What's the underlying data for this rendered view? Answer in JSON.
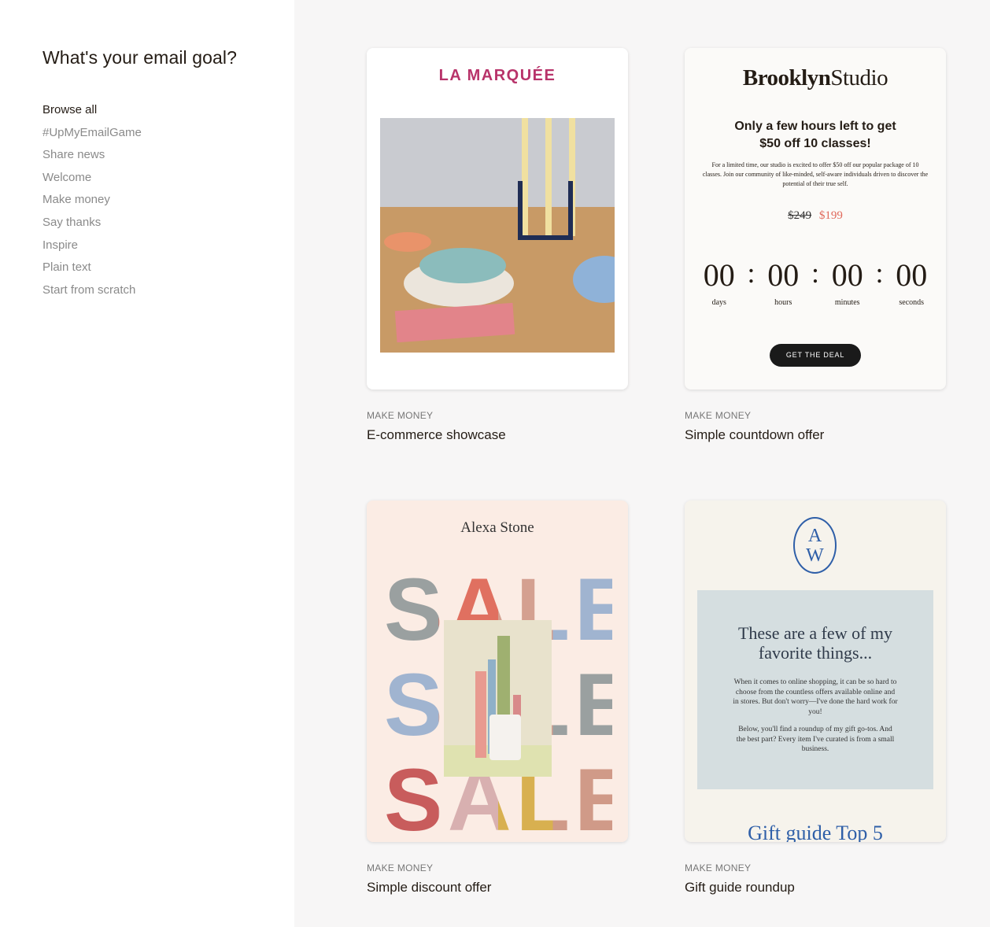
{
  "sidebar": {
    "title": "What's your email goal?",
    "items": [
      "Browse all",
      "#UpMyEmailGame",
      "Share news",
      "Welcome",
      "Make money",
      "Say thanks",
      "Inspire",
      "Plain text",
      "Start from scratch"
    ]
  },
  "templates": [
    {
      "category": "MAKE MONEY",
      "name": "E-commerce showcase",
      "brand": "LA MARQUÉE"
    },
    {
      "category": "MAKE MONEY",
      "name": "Simple countdown offer",
      "brand_bold": "Brooklyn",
      "brand_light": "Studio",
      "headline1": "Only a few hours left to get",
      "headline2": "$50 off 10 classes!",
      "body": "For a limited time, our studio is excited to offer $50 off our popular package of 10 classes. Join our community of like-minded, self-aware individuals driven to discover the potential of their true self.",
      "old_price": "$249",
      "new_price": "$199",
      "timer": [
        {
          "v": "00",
          "l": "days"
        },
        {
          "v": "00",
          "l": "hours"
        },
        {
          "v": "00",
          "l": "minutes"
        },
        {
          "v": "00",
          "l": "seconds"
        }
      ],
      "cta": "GET THE DEAL"
    },
    {
      "category": "MAKE MONEY",
      "name": "Simple discount offer",
      "brand": "Alexa Stone",
      "sale": "SALE"
    },
    {
      "category": "MAKE MONEY",
      "name": "Gift guide roundup",
      "monogram_top": "A",
      "monogram_bottom": "W",
      "heading": "These are a few of my favorite things...",
      "p1": "When it comes to online shopping, it can be so hard to choose from the countless offers available online and in stores. But don't worry—I've done the hard work for you!",
      "p2": "Below, you'll find a roundup of my gift go-tos. And the best part? Every item I've curated is from a small business.",
      "footer": "Gift guide Top 5"
    }
  ],
  "colors": {
    "brand_pink": "#b8336a",
    "sale_red": "#e07060",
    "price_red": "#e0685a",
    "gift_blue": "#2f5fa8"
  }
}
